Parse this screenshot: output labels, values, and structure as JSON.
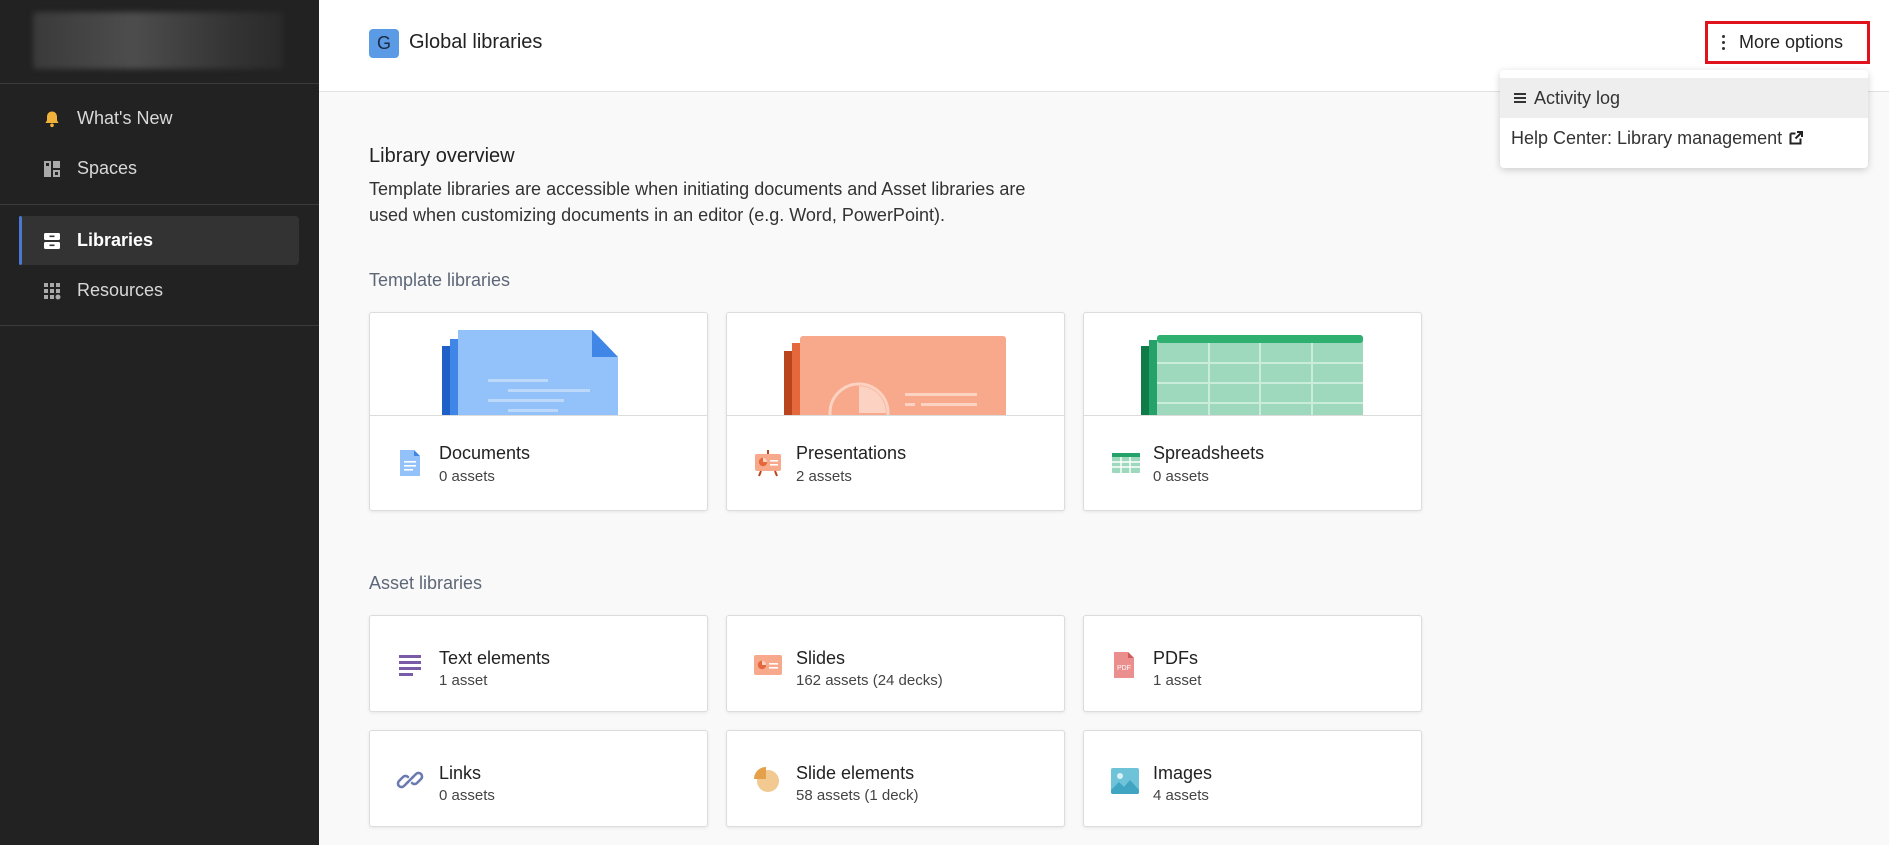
{
  "sidebar": {
    "items": [
      {
        "label": "What's New",
        "icon": "bell-icon"
      },
      {
        "label": "Spaces",
        "icon": "dashboard-icon"
      },
      {
        "label": "Libraries",
        "icon": "archive-icon",
        "active": true
      },
      {
        "label": "Resources",
        "icon": "grid-icon"
      }
    ]
  },
  "header": {
    "badge": "G",
    "title": "Global libraries",
    "more_options": "More options"
  },
  "menu": {
    "items": [
      {
        "label": "Activity log",
        "icon": "list-icon"
      },
      {
        "label": "Help Center: Library management",
        "icon": "external-link-icon"
      }
    ]
  },
  "overview": {
    "title": "Library overview",
    "description": "Template libraries are accessible when initiating documents and Asset libraries are used when customizing documents in an editor (e.g. Word, PowerPoint)."
  },
  "template_libraries": {
    "title": "Template libraries",
    "cards": [
      {
        "name": "Documents",
        "count": "0 assets",
        "icon": "document-icon"
      },
      {
        "name": "Presentations",
        "count": "2 assets",
        "icon": "presentation-icon"
      },
      {
        "name": "Spreadsheets",
        "count": "0 assets",
        "icon": "spreadsheet-icon"
      }
    ]
  },
  "asset_libraries": {
    "title": "Asset libraries",
    "cards": [
      {
        "name": "Text elements",
        "count": "1 asset",
        "icon": "text-lines-icon"
      },
      {
        "name": "Slides",
        "count": "162 assets (24 decks)",
        "icon": "slide-icon"
      },
      {
        "name": "PDFs",
        "count": "1 asset",
        "icon": "pdf-icon"
      },
      {
        "name": "Links",
        "count": "0 assets",
        "icon": "link-icon"
      },
      {
        "name": "Slide elements",
        "count": "58 assets (1 deck)",
        "icon": "pie-chart-icon"
      },
      {
        "name": "Images",
        "count": "4 assets",
        "icon": "image-icon"
      }
    ]
  },
  "colors": {
    "sidebar_bg": "#222222",
    "accent": "#4a78d0",
    "highlight_border": "#e0131d",
    "documents": "#93c1f9",
    "presentations": "#f8a98b",
    "spreadsheets": "#9fd9bd"
  }
}
